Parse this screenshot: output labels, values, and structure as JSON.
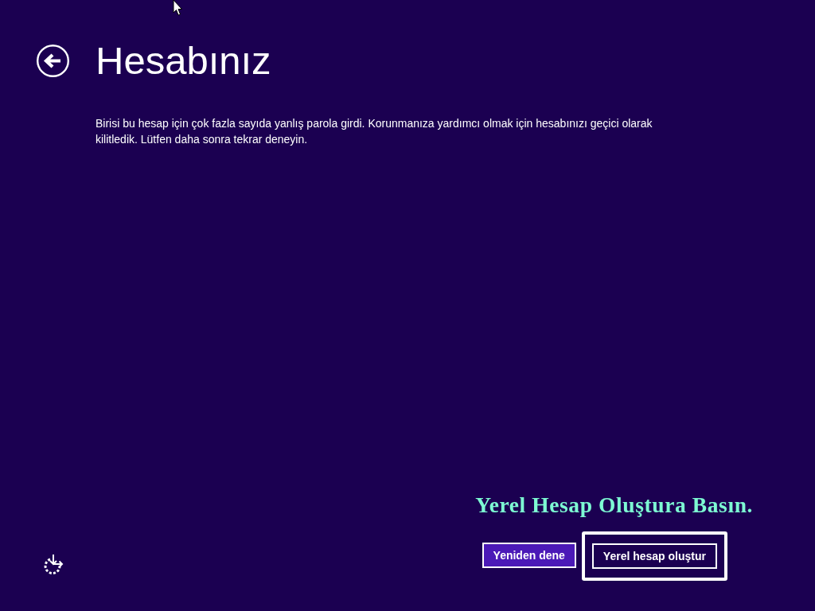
{
  "header": {
    "title": "Hesabınız"
  },
  "message": "Birisi bu hesap için çok fazla sayıda yanlış parola girdi. Korunmanıza yardımcı olmak için hesabınızı geçici olarak kilitledik. Lütfen daha sonra tekrar deneyin.",
  "annotation": {
    "text": "Yerel Hesap Oluştura Basın."
  },
  "buttons": [
    {
      "label": "Yeniden dene",
      "kind": "primary",
      "highlighted": false
    },
    {
      "label": "Yerel hesap oluştur",
      "kind": "outline",
      "highlighted": true
    }
  ]
}
